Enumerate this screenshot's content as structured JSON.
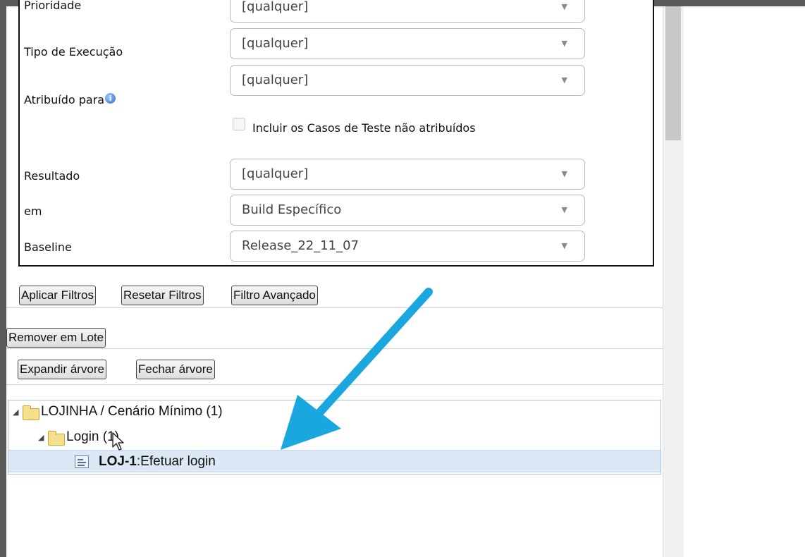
{
  "filters": {
    "prioridade": {
      "label": "Prioridade",
      "value": "[qualquer]"
    },
    "tipo_execucao": {
      "label": "Tipo de Execução",
      "value": "[qualquer]"
    },
    "atribuido_para": {
      "label": "Atribuído para",
      "value": "[qualquer]",
      "info_icon": "info-icon"
    },
    "incluir_nao_atribuidos": {
      "label": "Incluir os Casos de Teste não atribuídos",
      "checked": false
    },
    "resultado": {
      "label": "Resultado",
      "value": "[qualquer]"
    },
    "em": {
      "label": "em",
      "value": "Build Específico"
    },
    "baseline": {
      "label": "Baseline",
      "value": "Release_22_11_07"
    }
  },
  "buttons": {
    "aplicar": "Aplicar Filtros",
    "resetar": "Resetar Filtros",
    "avancado": "Filtro Avançado",
    "remover_lote": "Remover em Lote",
    "expandir": "Expandir árvore",
    "fechar": "Fechar árvore"
  },
  "tree": {
    "root": {
      "label": "LOJINHA / Cenário Mínimo (1)"
    },
    "folder": {
      "label": "Login (1)"
    },
    "item": {
      "id": "LOJ-1",
      "sep": ":",
      "title": "Efetuar login"
    }
  },
  "colors": {
    "annotation_arrow": "#1aa7e0",
    "selected_row": "#dde8f7",
    "frame": "#5a5a5a"
  }
}
